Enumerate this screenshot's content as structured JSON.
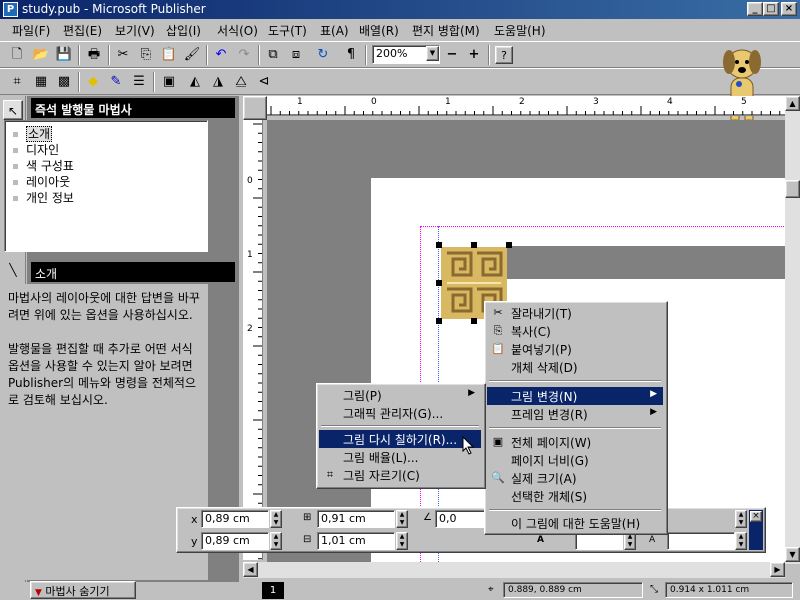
{
  "window": {
    "title": "study.pub - Microsoft Publisher",
    "app_icon": "publisher-icon"
  },
  "menu": [
    "파일(F)",
    "편집(E)",
    "보기(V)",
    "삽입(I)",
    "서식(O)",
    "도구(T)",
    "표(A)",
    "배열(R)",
    "편지 병합(M)",
    "도움말(H)"
  ],
  "toolbar": {
    "zoom": "200%"
  },
  "wizard": {
    "header": "즉석 발행물 마법사",
    "items": [
      "소개",
      "디자인",
      "색 구성표",
      "레이아웃",
      "개인 정보"
    ],
    "desc_header": "소개",
    "desc_p1": "마법사의 레이아웃에 대한 답변을 바꾸려면 위에 있는 옵션을 사용하십시오.",
    "desc_p2": "발행물을 편집할 때 추가로 어떤 서식 옵션을 사용할 수 있는지 알아 보려면 Publisher의 메뉴와 명령을 전체적으로 검토해 보십시오."
  },
  "hruler_nums": [
    "1",
    "0",
    "1",
    "2",
    "3",
    "4",
    "5"
  ],
  "vruler_nums": [
    "0",
    "1",
    "2"
  ],
  "context_menu_main": {
    "items": [
      "잘라내기(T)",
      "복사(C)",
      "붙여넣기(P)",
      "개체 삭제(D)",
      "그림 변경(N)",
      "프레임 변경(R)",
      "전체 페이지(W)",
      "페이지 너비(G)",
      "실제 크기(A)",
      "선택한 개체(S)",
      "이 그림에 대한 도움말(H)"
    ]
  },
  "context_menu_sub": {
    "items": [
      "그림(P)",
      "그래픽 관리자(G)...",
      "그림 다시 칠하기(R)...",
      "그림 배율(L)...",
      "그림 자르기(C)"
    ]
  },
  "measure": {
    "x_label": "x",
    "y_label": "y",
    "x": "0,89 cm",
    "y": "0,89 cm",
    "w": "0,91 cm",
    "h": "1,01 cm",
    "rot": "0,0",
    "font_fx": "A"
  },
  "status": {
    "hide_wizard": "마법사 숨기기",
    "page": "1",
    "position": "0.889, 0.889 cm",
    "size": "0.914 x 1.011 cm"
  }
}
